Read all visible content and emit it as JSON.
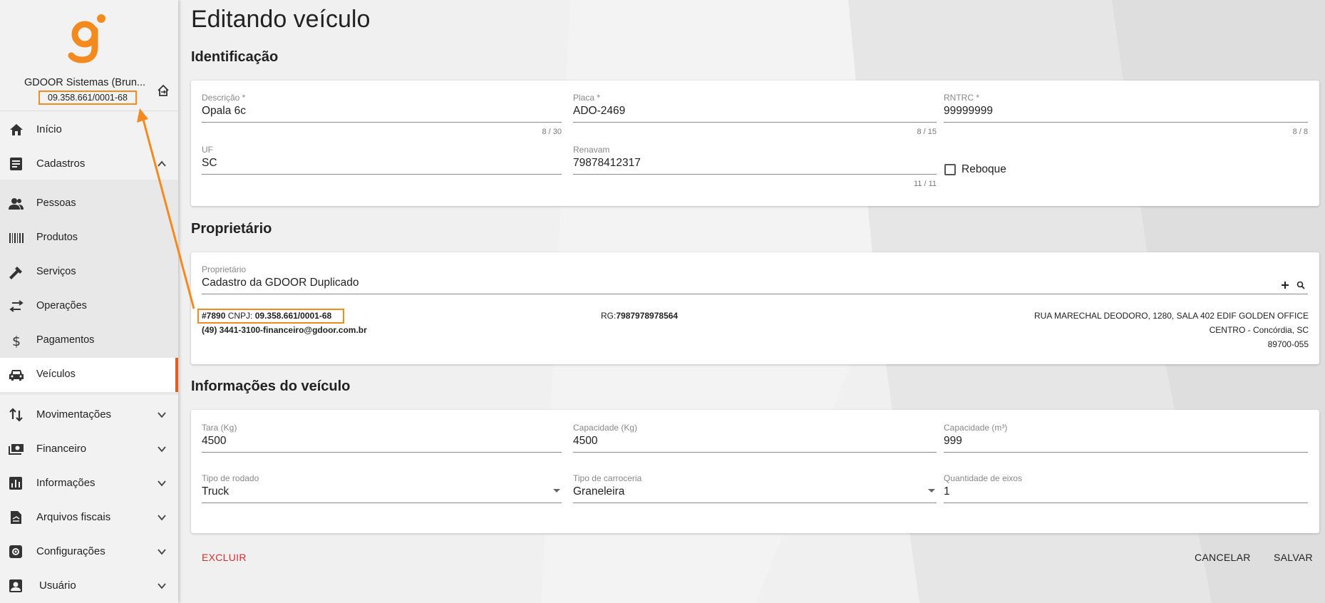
{
  "colors": {
    "accent": "#e65c1c",
    "highlight": "#f28a1e",
    "danger": "#d32f2f",
    "logo": "#f28a1e"
  },
  "sidebar": {
    "company_name": "GDOOR Sistemas (Brun...",
    "company_cnpj": "09.358.661/0001-68",
    "items": [
      {
        "label": "Início",
        "icon": "home-icon"
      },
      {
        "label": "Cadastros",
        "icon": "list-icon"
      },
      {
        "label": "Pessoas",
        "icon": "people-icon"
      },
      {
        "label": "Produtos",
        "icon": "barcode-icon"
      },
      {
        "label": "Serviços",
        "icon": "hammer-icon"
      },
      {
        "label": "Operações",
        "icon": "swap-icon"
      },
      {
        "label": "Pagamentos",
        "icon": "dollar-icon"
      },
      {
        "label": "Veículos",
        "icon": "car-icon"
      },
      {
        "label": "Movimentações",
        "icon": "sort-icon"
      },
      {
        "label": "Financeiro",
        "icon": "money-icon"
      },
      {
        "label": "Informações",
        "icon": "chart-icon"
      },
      {
        "label": "Arquivos fiscais",
        "icon": "file-icon"
      },
      {
        "label": "Configurações",
        "icon": "settings-icon"
      },
      {
        "label": "Usuário",
        "icon": "user-icon"
      }
    ]
  },
  "page": {
    "title": "Editando veículo"
  },
  "identificacao": {
    "title": "Identificação",
    "descricao": {
      "label": "Descrição *",
      "value": "Opala 6c",
      "count": "8 / 30"
    },
    "placa": {
      "label": "Placa *",
      "value": "ADO-2469",
      "count": "8 / 15"
    },
    "rntrc": {
      "label": "RNTRC *",
      "value": "99999999",
      "count": "8 / 8"
    },
    "uf": {
      "label": "UF",
      "value": "SC"
    },
    "renavam": {
      "label": "Renavam",
      "value": "79878412317",
      "count": "11 / 11"
    },
    "reboque": {
      "label": "Reboque"
    }
  },
  "proprietario": {
    "title": "Proprietário",
    "field": {
      "label": "Proprietário",
      "value": "Cadastro da GDOOR Duplicado"
    },
    "code": "#7890",
    "cnpj_label": "CNPJ:",
    "cnpj": "09.358.661/0001-68",
    "phone_email": "(49) 3441-3100-financeiro@gdoor.com.br",
    "rg_label": "RG:",
    "rg": "7987978978564",
    "address1": "RUA MARECHAL DEODORO, 1280, SALA 402 EDIF GOLDEN OFFICE",
    "address2": "CENTRO - Concórdia, SC",
    "cep": "89700-055"
  },
  "informacoes": {
    "title": "Informações do veículo",
    "tara": {
      "label": "Tara (Kg)",
      "value": "4500"
    },
    "capacidade_kg": {
      "label": "Capacidade (Kg)",
      "value": "4500"
    },
    "capacidade_m3": {
      "label": "Capacidade (m³)",
      "value": "999"
    },
    "tipo_rodado": {
      "label": "Tipo de rodado",
      "value": "Truck"
    },
    "tipo_carroceria": {
      "label": "Tipo de carroceria",
      "value": "Graneleira"
    },
    "eixos": {
      "label": "Quantidade de eixos",
      "value": "1"
    }
  },
  "actions": {
    "delete": "EXCLUIR",
    "cancel": "CANCELAR",
    "save": "SALVAR"
  }
}
